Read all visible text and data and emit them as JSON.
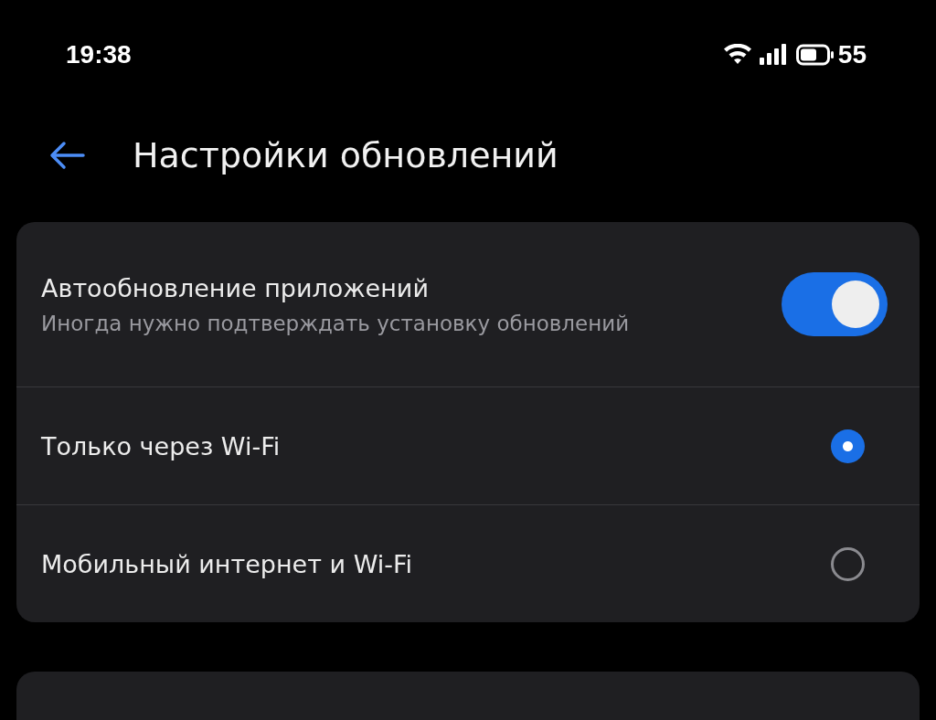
{
  "status_bar": {
    "time": "19:38",
    "battery": "55"
  },
  "header": {
    "title": "Настройки обновлений"
  },
  "settings": [
    {
      "kind": "toggle",
      "title": "Автообновление приложений",
      "subtitle": "Иногда нужно подтверждать установку обновлений",
      "on": true
    },
    {
      "kind": "radio",
      "title": "Только через Wi-Fi",
      "selected": true
    },
    {
      "kind": "radio",
      "title": "Мобильный интернет и Wi-Fi",
      "selected": false
    }
  ]
}
